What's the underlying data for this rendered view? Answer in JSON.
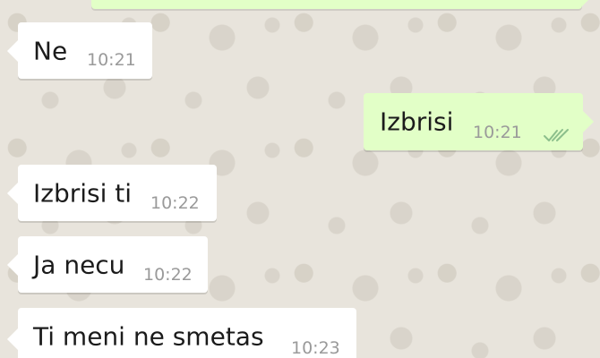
{
  "chat": {
    "messages": [
      {
        "direction": "out",
        "text": "",
        "time": ""
      },
      {
        "direction": "in",
        "text": "Ne",
        "time": "10:21"
      },
      {
        "direction": "out",
        "text": "Izbrisi",
        "time": "10:21",
        "status_icon": "double-check-icon"
      },
      {
        "direction": "in",
        "text": "Izbrisi ti",
        "time": "10:22"
      },
      {
        "direction": "in",
        "text": "Ja necu",
        "time": "10:22"
      },
      {
        "direction": "in",
        "text": "Ti meni ne smetas",
        "time": "10:23"
      }
    ]
  },
  "colors": {
    "wallpaper": "#e8e4dc",
    "incoming_bubble": "#ffffff",
    "outgoing_bubble": "#e2ffc7",
    "timestamp": "#9a9a9a",
    "read_check": "#8cbf8c"
  }
}
